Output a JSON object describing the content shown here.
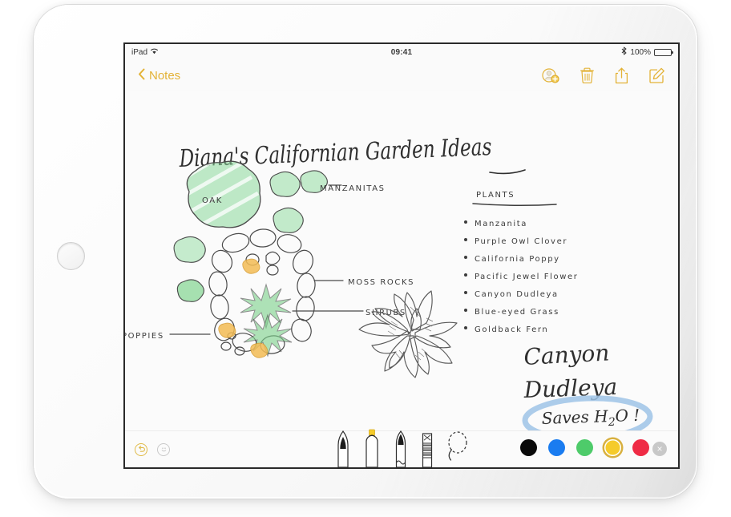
{
  "device": {
    "name": "iPad",
    "home_button": "home-button"
  },
  "status_bar": {
    "device_label": "iPad",
    "wifi_icon": "wifi-icon",
    "time": "09:41",
    "bluetooth_icon": "bluetooth-icon",
    "battery_percent": "100%",
    "battery_icon": "battery-icon"
  },
  "nav_bar": {
    "back_label": "Notes",
    "back_chevron": "chevron-left-icon",
    "actions": [
      {
        "name": "add-people-icon",
        "label": "Add People"
      },
      {
        "name": "trash-icon",
        "label": "Delete"
      },
      {
        "name": "share-icon",
        "label": "Share"
      },
      {
        "name": "compose-icon",
        "label": "Compose"
      }
    ],
    "accent_color": "#e3b236"
  },
  "note": {
    "title": "Diana's Californian Garden Ideas",
    "plants_heading": "PLANTS",
    "plants": [
      "Manzanita",
      "Purple Owl Clover",
      "California Poppy",
      "Pacific Jewel Flower",
      "Canyon Dudleya",
      "Blue-eyed Grass",
      "Goldback Fern"
    ],
    "sketch_labels": {
      "oak": "OAK",
      "manzanitas": "MANZANITAS",
      "moss_rocks": "MOSS ROCKS",
      "shrubs": "SHRUBS",
      "poppies": "POPPIES"
    },
    "succulent_caption_line1": "Canyon",
    "succulent_caption_line2": "Dudleya",
    "annotation": "Saves H2O !",
    "annotation_display": "Saves H",
    "annotation_sub": "2",
    "annotation_tail": "O !",
    "annotation_circle_color": "#9dc3e6",
    "ink_color": "#2f2f2f",
    "foliage_color": "#6ecf7e",
    "poppy_color": "#f0b040"
  },
  "draw_toolbar": {
    "undo_icon": "undo-icon",
    "emoji_icon": "smiley-icon",
    "tools": [
      {
        "name": "pen-tool",
        "label": "Pen"
      },
      {
        "name": "highlighter-tool",
        "label": "Highlighter"
      },
      {
        "name": "pencil-tool",
        "label": "Pencil"
      },
      {
        "name": "eraser-tool",
        "label": "Eraser"
      },
      {
        "name": "lasso-tool",
        "label": "Lasso"
      }
    ],
    "colors": [
      {
        "name": "swatch-black",
        "hex": "#0a0a0a",
        "selected": false
      },
      {
        "name": "swatch-blue",
        "hex": "#1a7cf0",
        "selected": false
      },
      {
        "name": "swatch-green",
        "hex": "#4ecb6a",
        "selected": false
      },
      {
        "name": "swatch-yellow",
        "hex": "#f5cb2b",
        "selected": true
      },
      {
        "name": "swatch-red",
        "hex": "#ef2b45",
        "selected": false
      }
    ],
    "close_label": "×"
  }
}
